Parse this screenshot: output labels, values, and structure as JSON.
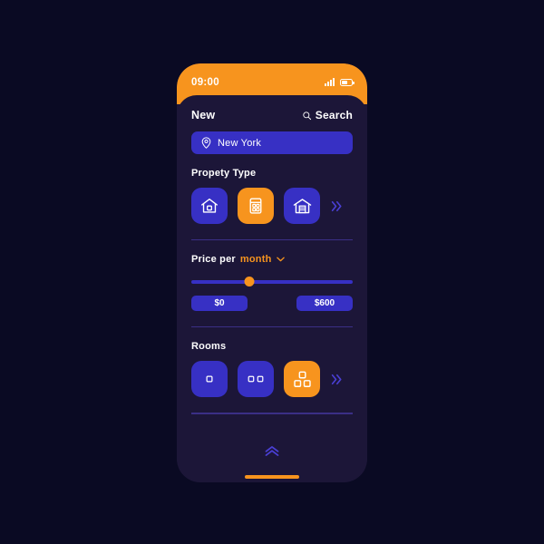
{
  "theme": {
    "page_background": "#0a0a23",
    "phone_background": "#1c1638",
    "accent_orange": "#f7941e",
    "tile_blue": "#3730c4",
    "divider": "#3b2f86",
    "text_primary": "#ffffff"
  },
  "status_bar": {
    "time": "09:00",
    "signal_icon": "signal-bars-icon",
    "battery_icon": "battery-icon"
  },
  "header": {
    "title": "New",
    "search_icon": "search-icon",
    "search_label": "Search"
  },
  "location": {
    "pin_icon": "location-pin-icon",
    "value": "New York",
    "placeholder": "New York"
  },
  "property_type": {
    "title": "Propety Type",
    "more_icon": "double-chevron-right-icon",
    "options": [
      {
        "icon": "house-icon",
        "label": "House",
        "selected": false
      },
      {
        "icon": "apartment-icon",
        "label": "Apartment",
        "selected": true
      },
      {
        "icon": "warehouse-icon",
        "label": "Warehouse",
        "selected": false
      }
    ]
  },
  "price": {
    "label": "Price per",
    "unit": "month",
    "dropdown_icon": "chevron-down-icon",
    "slider_percent": 36,
    "min_value": "$0",
    "max_value": "$600"
  },
  "rooms": {
    "title": "Rooms",
    "more_icon": "double-chevron-right-icon",
    "options": [
      {
        "icon": "one-room-icon",
        "label": "1",
        "selected": false
      },
      {
        "icon": "two-rooms-icon",
        "label": "2",
        "selected": false
      },
      {
        "icon": "three-rooms-icon",
        "label": "3",
        "selected": true
      }
    ]
  },
  "bottom": {
    "expand_icon": "double-chevron-up-icon",
    "home_indicator": "home-indicator"
  }
}
